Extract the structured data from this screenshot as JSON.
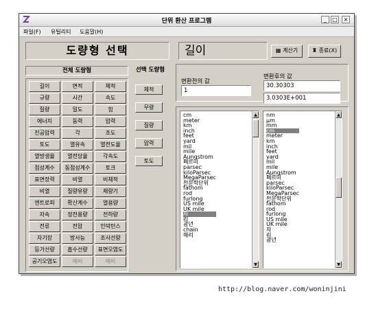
{
  "window": {
    "title": "단위 환산 프로그램",
    "controls": [
      "_",
      "□",
      "×"
    ]
  },
  "menu": [
    "파일(F)",
    "유틸리티",
    "도움말(H)"
  ],
  "header": {
    "main_title": "도량형 선택",
    "current_category": "길이",
    "calc_button": "계산기",
    "exit_button": "종료(X)"
  },
  "all_units_header": "전체 도량형",
  "selected_units_header": "선택 도량형",
  "categories": [
    "길이",
    "면적",
    "체적",
    "규량",
    "시간",
    "속도",
    "질량",
    "밀도",
    "힘",
    "에너지",
    "동력",
    "압력",
    "진공압력",
    "각",
    "조도",
    "토도",
    "열유속",
    "열전도율",
    "열방생율",
    "열전당율",
    "각속도",
    "점성계수",
    "동점성계수",
    "토크",
    "표면장력",
    "비열",
    "비체적",
    "비열",
    "질량유량",
    "체량기",
    "엔트로피",
    "확산계수",
    "열용량",
    "자속",
    "정전용량",
    "전하량",
    "전류",
    "전압",
    "인덕턴스",
    "자기장",
    "방사능",
    "조사선량",
    "등가선량",
    "흡수선량",
    "표면오염도",
    "공기오염도",
    "예비",
    "예비"
  ],
  "disabled_categories": [
    46,
    47
  ],
  "selected_buttons": [
    "체적",
    "무량",
    "질량",
    "압력",
    "토도"
  ],
  "before_label": "변환전의 값",
  "before_value": "1",
  "after_label": "변환후의 값",
  "after_value_1": "30.30303",
  "after_value_2": "3.0303E+001",
  "left_units": [
    "cm",
    "meter",
    "km",
    "inch",
    "feet",
    "yard",
    "mil",
    "mile",
    "Aungstrom",
    "페르미",
    "parsec",
    "kiloParsec",
    "MegaParsec",
    "천문학단위",
    "fathom",
    "rod",
    "furlong",
    "US mile",
    "UK mile",
    "자",
    "리",
    "광년",
    "chain",
    "해리"
  ],
  "left_selected_index": 19,
  "right_units": [
    "nm",
    "μm",
    "mm",
    "cm",
    "meter",
    "km",
    "inch",
    "feet",
    "yard",
    "mil",
    "mile",
    "Aungstrom",
    "페르미",
    "parsec",
    "kiloParsec",
    "MegaParsec",
    "천문학단위",
    "fathom",
    "rod",
    "furlong",
    "US mile",
    "UK mile",
    "자",
    "리",
    "광년"
  ],
  "right_selected_index": 3,
  "watermark": "http://blog.naver.com/woninjini"
}
